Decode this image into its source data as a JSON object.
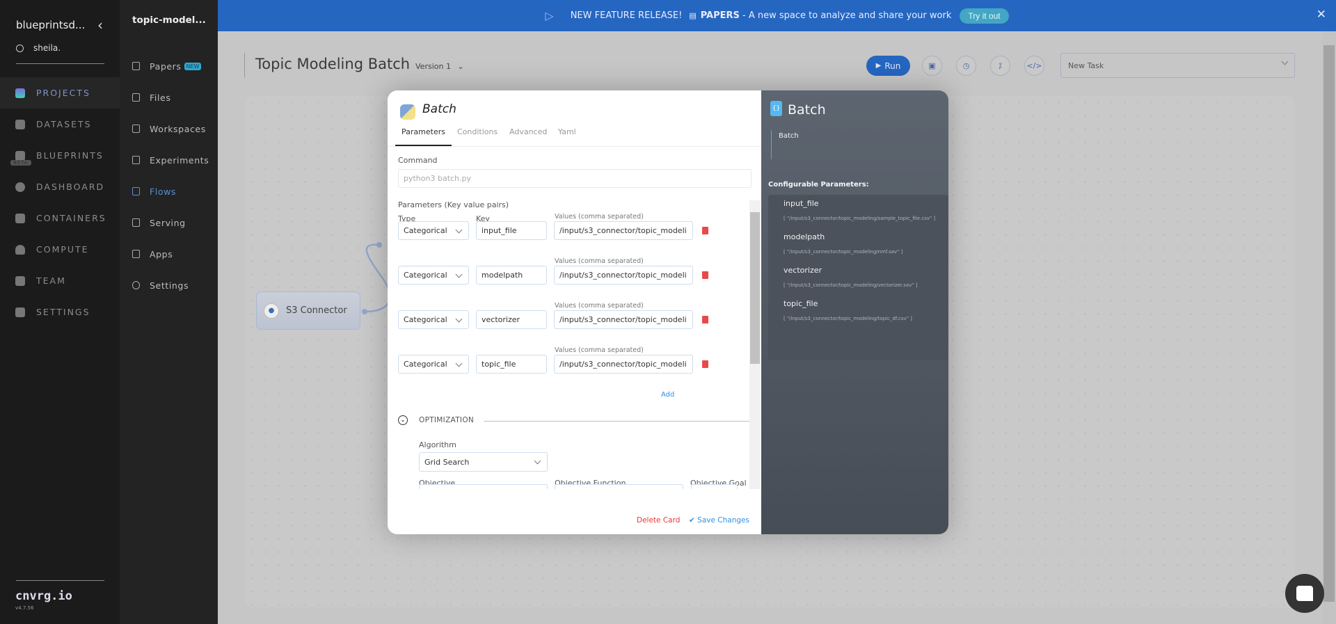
{
  "sidebar": {
    "org": "blueprintsd...",
    "user": "sheila.",
    "items": [
      {
        "label": "PROJECTS",
        "icon": "projects-icon",
        "active": true
      },
      {
        "label": "DATASETS",
        "icon": "database-icon"
      },
      {
        "label": "BLUEPRINTS",
        "icon": "books-icon",
        "badge": "BETA"
      },
      {
        "label": "DASHBOARD",
        "icon": "dashboard-icon"
      },
      {
        "label": "CONTAINERS",
        "icon": "containers-icon"
      },
      {
        "label": "COMPUTE",
        "icon": "cloud-icon"
      },
      {
        "label": "TEAM",
        "icon": "team-icon"
      },
      {
        "label": "SETTINGS",
        "icon": "gears-icon"
      }
    ],
    "brand": "cnvrg.io",
    "version": "v4.7.56"
  },
  "project_nav": {
    "title": "topic-model...",
    "items": [
      {
        "label": "Papers",
        "badge": "NEW",
        "icon": "papers-icon"
      },
      {
        "label": "Files",
        "icon": "file-icon"
      },
      {
        "label": "Workspaces",
        "icon": "clipboard-icon"
      },
      {
        "label": "Experiments",
        "icon": "flask-icon"
      },
      {
        "label": "Flows",
        "icon": "flows-icon",
        "active": true
      },
      {
        "label": "Serving",
        "icon": "rocket-icon"
      },
      {
        "label": "Apps",
        "icon": "apps-icon"
      },
      {
        "label": "Settings",
        "icon": "gear-icon"
      }
    ]
  },
  "banner": {
    "lead": "NEW FEATURE RELEASE!",
    "bold": "PAPERS",
    "text": " - A new space to analyze and share your work",
    "button": "Try it out"
  },
  "header": {
    "title": "Topic Modeling Batch",
    "version": "Version 1",
    "run": "Run",
    "task_select": "New Task"
  },
  "canvas": {
    "node": "S3 Connector"
  },
  "modal": {
    "title": "Batch",
    "tabs": [
      "Parameters",
      "Conditions",
      "Advanced",
      "Yaml"
    ],
    "command_label": "Command",
    "command_placeholder": "python3 batch.py",
    "params_label": "Parameters (Key value pairs)",
    "type_label": "Type",
    "key_label": "Key",
    "values_label": "Values (comma separated)",
    "params": [
      {
        "type": "Categorical",
        "key": "input_file",
        "value": "/input/s3_connector/topic_modeli"
      },
      {
        "type": "Categorical",
        "key": "modelpath",
        "value": "/input/s3_connector/topic_modeli"
      },
      {
        "type": "Categorical",
        "key": "vectorizer",
        "value": "/input/s3_connector/topic_modeli"
      },
      {
        "type": "Categorical",
        "key": "topic_file",
        "value": "/input/s3_connector/topic_modeli"
      }
    ],
    "add": "Add",
    "optimization": "OPTIMIZATION",
    "algorithm_label": "Algorithm",
    "algorithm": "Grid Search",
    "objective_label": "Objective",
    "objective_function_label": "Objective Function",
    "objective_goal_label": "Objective Goal",
    "delete": "Delete Card",
    "save": "Save Changes"
  },
  "summary": {
    "title": "Batch",
    "description": "Batch",
    "config_label": "Configurable Parameters:",
    "params": [
      {
        "key": "input_file",
        "value": "[ \"/input/s3_connector/topic_modeling/sample_topic_file.csv\" ]"
      },
      {
        "key": "modelpath",
        "value": "[ \"/input/s3_connector/topic_modeling/nmf.sav\" ]"
      },
      {
        "key": "vectorizer",
        "value": "[ \"/input/s3_connector/topic_modeling/vectorizer.sav\" ]"
      },
      {
        "key": "topic_file",
        "value": "[ \"/input/s3_connector/topic_modeling/topic_df.csv\" ]"
      }
    ]
  },
  "colors": {
    "accent": "#2566c1",
    "delete": "#e53935",
    "link": "#2f8fe0"
  }
}
